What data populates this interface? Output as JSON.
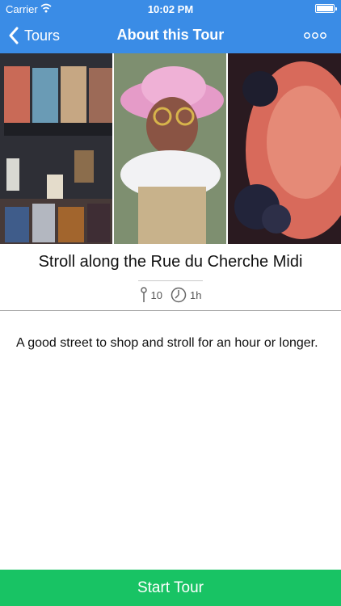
{
  "status": {
    "carrier": "Carrier",
    "time": "10:02 PM"
  },
  "nav": {
    "back_label": "Tours",
    "title": "About this Tour"
  },
  "tour": {
    "title": "Stroll along the Rue du Cherche Midi",
    "stops": "10",
    "duration": "1h",
    "description": "A good street to shop and stroll for an hour or longer."
  },
  "cta": {
    "label": "Start Tour"
  },
  "colors": {
    "accent": "#3a8ce6",
    "cta": "#18c364"
  },
  "icons": {
    "back": "chevron-left-icon",
    "more": "more-dots-icon",
    "stops": "pin-icon",
    "duration": "clock-icon",
    "wifi": "wifi-icon",
    "battery": "battery-icon"
  }
}
